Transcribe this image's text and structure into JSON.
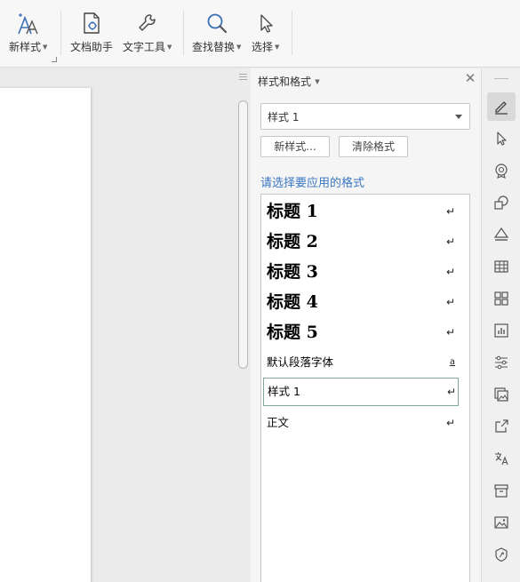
{
  "ribbon": {
    "new_style": "新样式",
    "doc_assistant": "文档助手",
    "text_tools": "文字工具",
    "find_replace": "查找替换",
    "select": "选择"
  },
  "pane": {
    "title": "样式和格式",
    "current_style": "样式 1",
    "new_style_button": "新样式...",
    "clear_format_button": "清除格式",
    "hint": "请选择要应用的格式",
    "styles": [
      {
        "label": "标题  1",
        "mark": "↵"
      },
      {
        "label": "标题  2",
        "mark": "↵"
      },
      {
        "label": "标题  3",
        "mark": "↵"
      },
      {
        "label": "标题 4",
        "mark": "↵"
      },
      {
        "label": "标题  5",
        "mark": "↵"
      },
      {
        "label": "默认段落字体",
        "mark": "a"
      },
      {
        "label": "样式 1",
        "mark": "↵"
      },
      {
        "label": "正文",
        "mark": "↵"
      }
    ]
  },
  "colors": {
    "accent": "#3a78c3",
    "selected_border": "#7fa7a0"
  }
}
